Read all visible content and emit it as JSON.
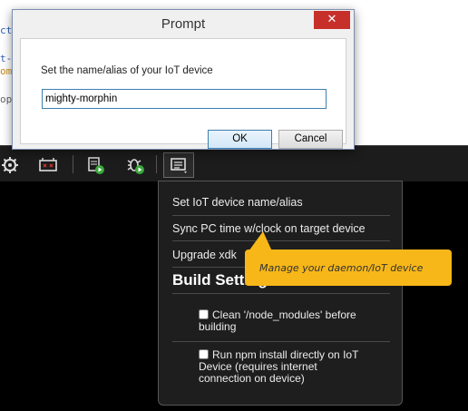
{
  "editor": {
    "fragments": [
      "ct",
      "t-",
      "om",
      "op"
    ]
  },
  "toolbar": {
    "icons": [
      "settings-gear-icon",
      "device-link-icon",
      "upload-run-icon",
      "debug-run-icon",
      "manage-device-icon"
    ]
  },
  "dialog": {
    "title": "Prompt",
    "close_label": "✕",
    "label": "Set the name/alias of your IoT device",
    "input_value": "mighty-morphin",
    "ok_label": "OK",
    "cancel_label": "Cancel"
  },
  "menu": {
    "items": [
      "Set IoT device name/alias",
      "Sync PC time w/clock on target device",
      "Upgrade xdk"
    ],
    "section_heading": "Build Settings",
    "checkboxes": [
      {
        "label": "Clean '/node_modules' before building",
        "checked": false
      },
      {
        "label": "Run npm install directly on IoT Device (requires internet connection on device)",
        "checked": false
      }
    ]
  },
  "tooltip": {
    "text": "Manage your daemon/IoT device"
  },
  "colors": {
    "tooltip_bg": "#f7b718",
    "menu_bg": "#1e1e1e",
    "close_button": "#c7302a",
    "focus_border": "#3c7fb1"
  }
}
